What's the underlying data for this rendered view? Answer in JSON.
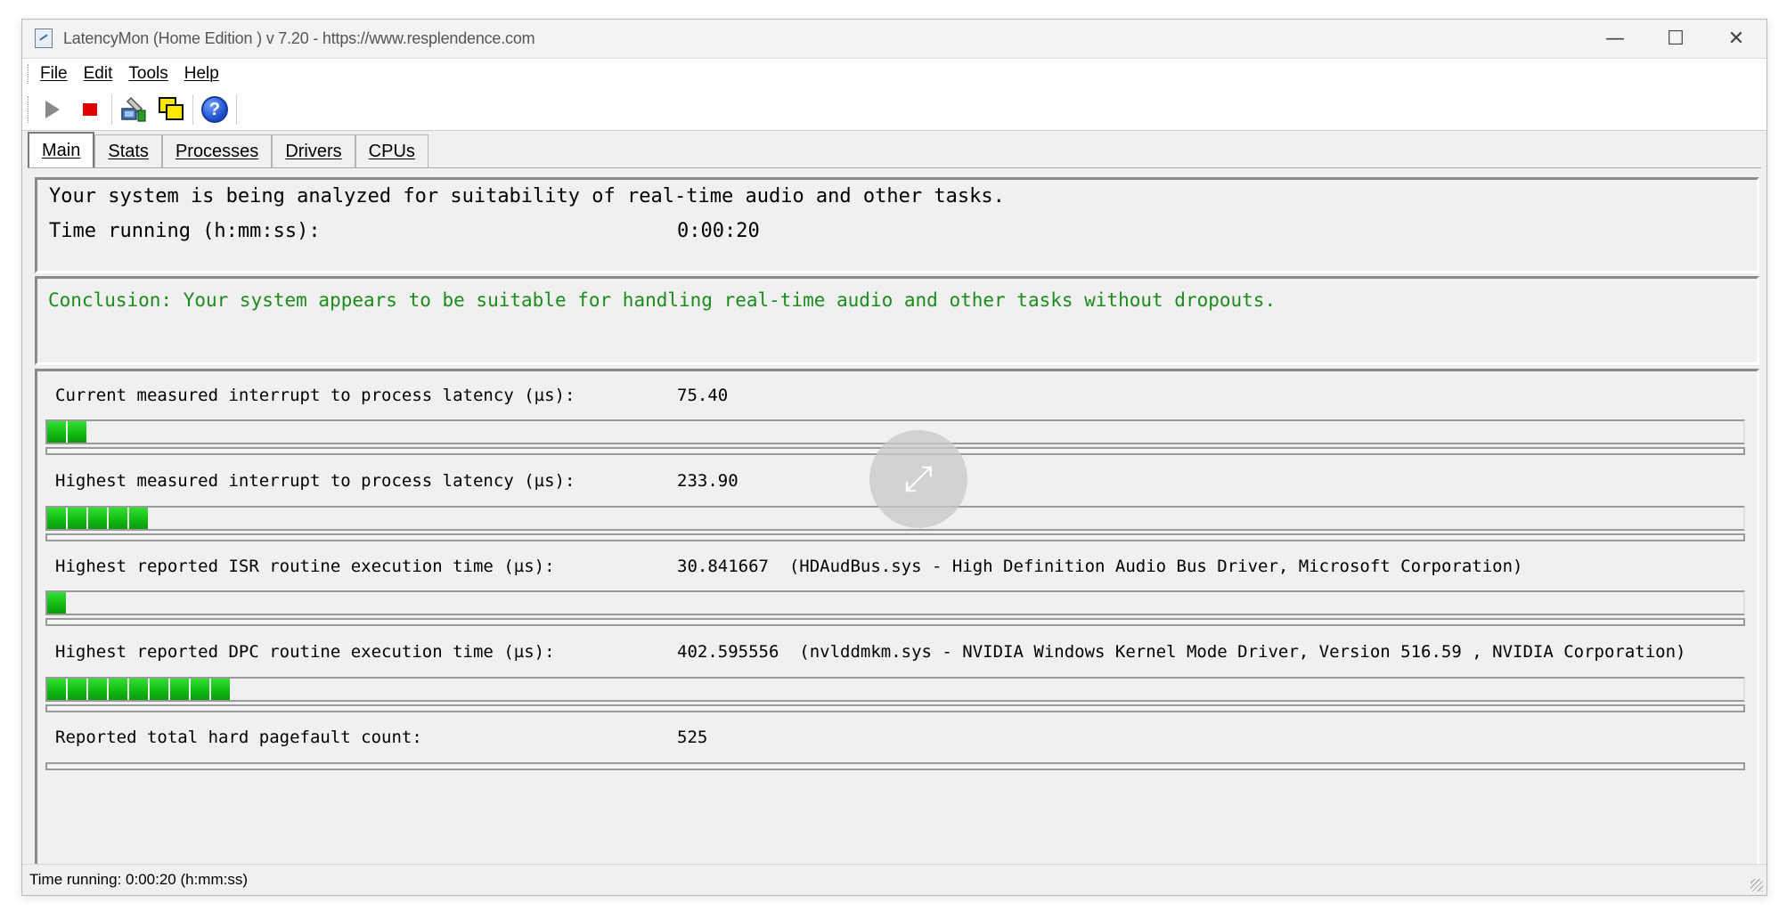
{
  "window": {
    "title": "LatencyMon  (Home Edition )  v 7.20 - https://www.resplendence.com",
    "controls": {
      "minimize": "—",
      "maximize": "☐",
      "close": "✕"
    }
  },
  "menu": [
    {
      "label": "File"
    },
    {
      "label": "Edit"
    },
    {
      "label": "Tools"
    },
    {
      "label": "Help"
    }
  ],
  "toolbar": {
    "buttons": [
      "play-icon",
      "stop-icon",
      "drivers-icon",
      "windows-icon",
      "help-icon"
    ],
    "help_glyph": "?"
  },
  "tabs": [
    {
      "label": "Main",
      "active": true
    },
    {
      "label": "Stats",
      "active": false
    },
    {
      "label": "Processes",
      "active": false
    },
    {
      "label": "Drivers",
      "active": false
    },
    {
      "label": "CPUs",
      "active": false
    }
  ],
  "summary": {
    "analyzing_text": "Your system is being analyzed for suitability of real-time audio and other tasks.",
    "time_label": "Time running (h:mm:ss):",
    "time_value": "0:00:20"
  },
  "conclusion": {
    "text": "Conclusion: Your system appears to be suitable for handling real-time audio and other tasks without dropouts.",
    "color": "#1b8c1b"
  },
  "metrics": [
    {
      "label": "Current measured interrupt to process latency (µs):",
      "value": "75.40",
      "detail": "",
      "bar_segments": 2
    },
    {
      "label": "Highest measured interrupt to process latency (µs):",
      "value": "233.90",
      "detail": "",
      "bar_segments": 5
    },
    {
      "label": "Highest reported ISR routine execution time (µs):",
      "value": "30.841667",
      "detail": "(HDAudBus.sys - High Definition Audio Bus Driver, Microsoft Corporation)",
      "bar_segments": 1
    },
    {
      "label": "Highest reported DPC routine execution time (µs):",
      "value": "402.595556",
      "detail": "(nvlddmkm.sys - NVIDIA Windows Kernel Mode Driver, Version 516.59 , NVIDIA Corporation)",
      "bar_segments": 9
    },
    {
      "label": "Reported total hard pagefault count:",
      "value": "525",
      "detail": "",
      "bar_segments": 0
    }
  ],
  "status_bar": {
    "text": "Time running: 0:00:20  (h:mm:ss)"
  },
  "colors": {
    "bar_fill": "#12b812",
    "stop": "#e00000"
  }
}
